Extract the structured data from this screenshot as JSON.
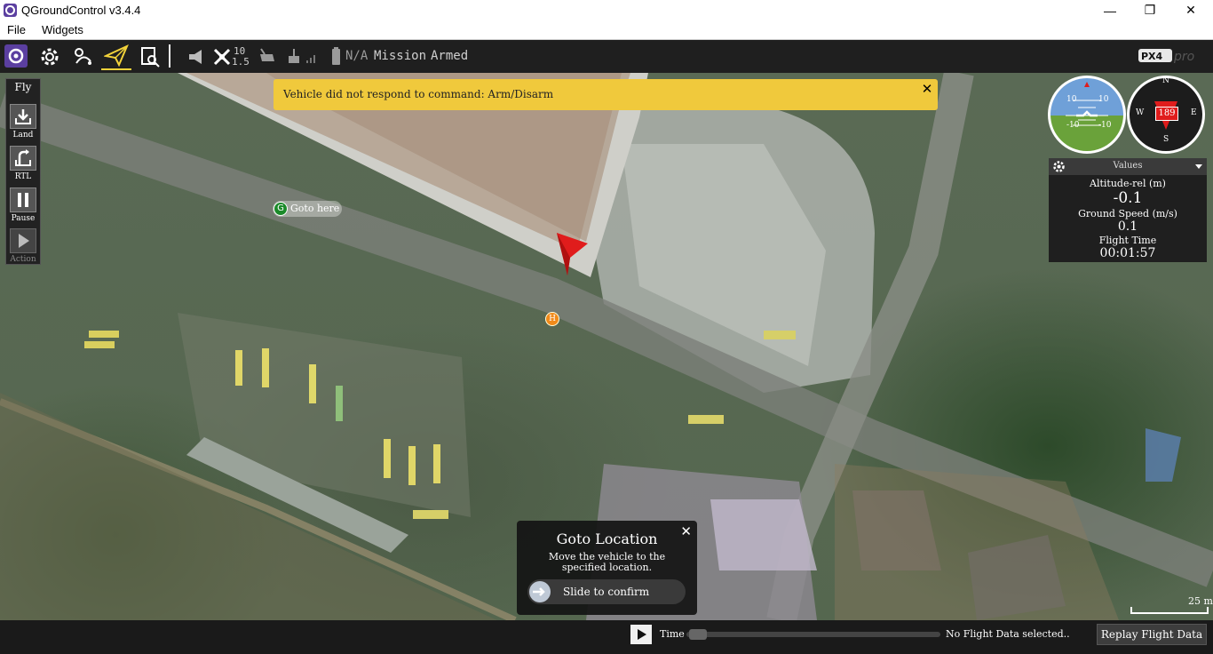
{
  "window": {
    "title": "QGroundControl v3.4.4",
    "minimize": "—",
    "restore": "❐",
    "close": "✕"
  },
  "menu": {
    "file": "File",
    "widgets": "Widgets"
  },
  "toolbar": {
    "gps_count": "10",
    "hdop": "1.5",
    "battery": "N/A",
    "flight_mode": "Mission",
    "arm_state": "Armed",
    "brand": "PX4 pro"
  },
  "fly_panel": {
    "title": "Fly",
    "land": "Land",
    "rtl": "RTL",
    "pause": "Pause",
    "action": "Action"
  },
  "alert": {
    "message": "Vehicle did not respond to command: Arm/Disarm",
    "close": "✕"
  },
  "map": {
    "goto_marker_letter": "G",
    "goto_marker_label": "Goto here",
    "home_marker": "H",
    "scale_label": "25 m"
  },
  "compass": {
    "heading": "189",
    "n": "N",
    "s": "S",
    "e": "E",
    "w": "W"
  },
  "attitude": {
    "pitch_plus": "10",
    "pitch_minus": "-10"
  },
  "values": {
    "title": "Values",
    "altitude_label": "Altitude-rel (m)",
    "altitude_value": "-0.1",
    "groundspeed_label": "Ground Speed (m/s)",
    "groundspeed_value": "0.1",
    "flighttime_label": "Flight Time",
    "flighttime_value": "00:01:57"
  },
  "goto_dialog": {
    "title": "Goto Location",
    "description": "Move the vehicle to the specified location.",
    "slider_label": "Slide to confirm",
    "close": "✕"
  },
  "bottom": {
    "time_label": "Time",
    "no_flight_data": "No Flight Data selected..",
    "replay_button": "Replay Flight Data"
  },
  "colors": {
    "alert": "#f0c93c",
    "toolbar": "#1f1f1f",
    "vehicle": "#e01c1c"
  }
}
